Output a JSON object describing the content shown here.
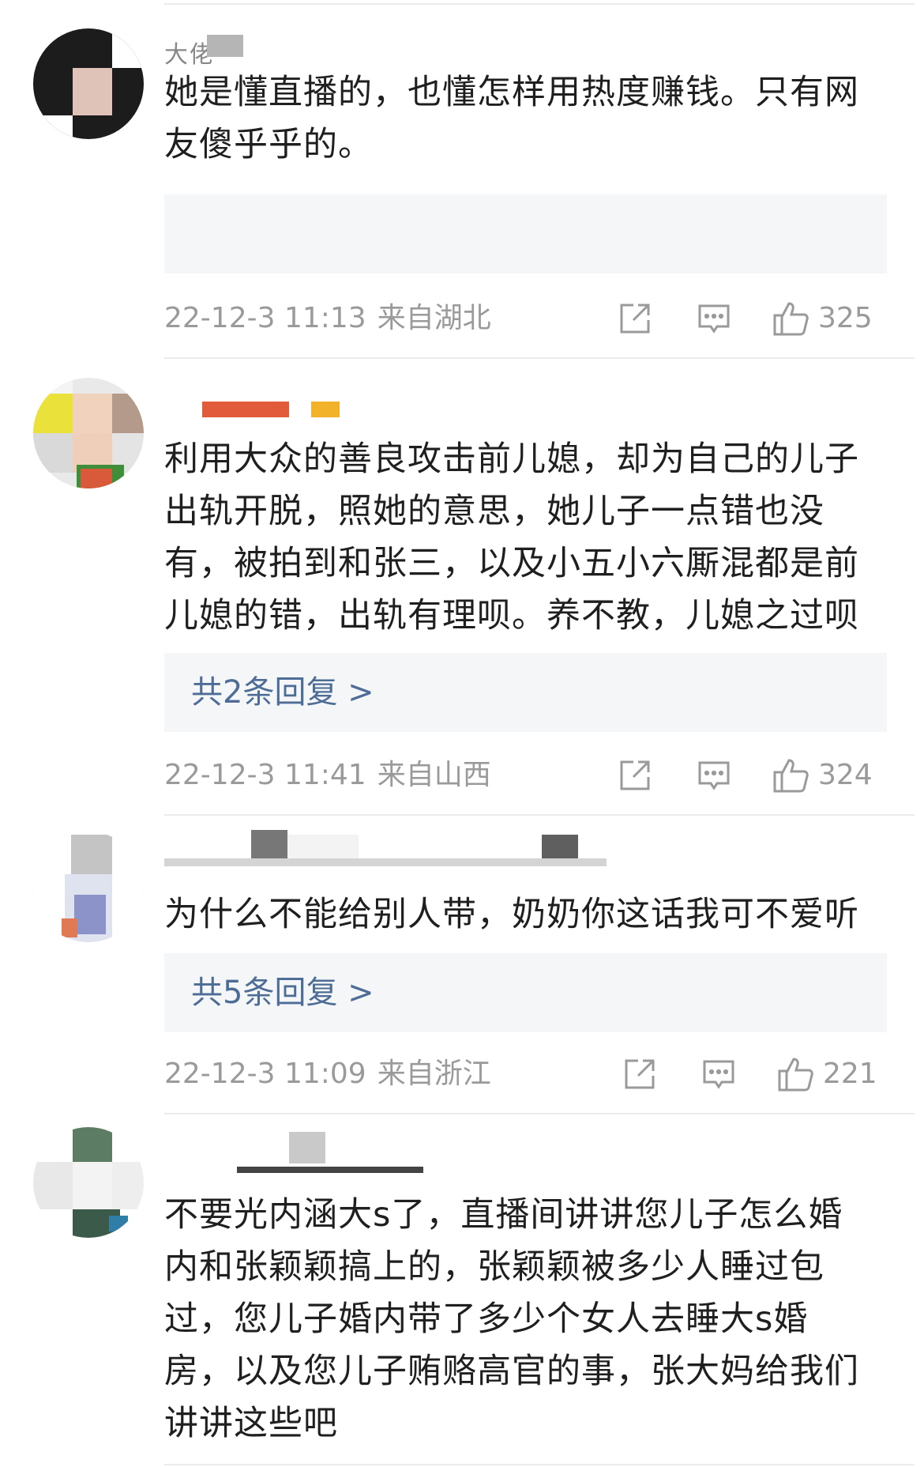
{
  "comments": [
    {
      "username": "大佬",
      "text_lines": [
        "她是懂直播的，也懂怎样用热度赚钱。只有网",
        "友傻乎乎的。"
      ],
      "reply_label": "",
      "time": "22-12-3 11:13",
      "location": "来自湖北",
      "likes": "325"
    },
    {
      "username": "",
      "text_lines": [
        "利用大众的善良攻击前儿媳，却为自己的儿子",
        "出轨开脱，照她的意思，她儿子一点错也没",
        "有，被拍到和张三，以及小五小六厮混都是前",
        "儿媳的错，出轨有理呗。养不教，儿媳之过呗"
      ],
      "reply_label": "共2条回复 >",
      "time": "22-12-3 11:41",
      "location": "来自山西",
      "likes": "324"
    },
    {
      "username": "",
      "text_lines": [
        "为什么不能给别人带，奶奶你这话我可不爱听"
      ],
      "reply_label": "共5条回复 >",
      "time": "22-12-3 11:09",
      "location": "来自浙江",
      "likes": "221"
    },
    {
      "username": "",
      "text_lines": [
        "不要光内涵大s了，直播间讲讲您儿子怎么婚",
        "内和张颖颖搞上的，张颖颖被多少人睡过包",
        "过，您儿子婚内带了多少个女人去睡大s婚",
        "房，以及您儿子贿赂高官的事，张大妈给我们",
        "讲讲这些吧"
      ]
    }
  ],
  "icons": {
    "share": "share-icon",
    "comment": "comment-icon",
    "like": "thumbs-up-icon"
  },
  "colors": {
    "reply_link": "#4e6d96",
    "meta_text": "#9a9a9a",
    "reply_bg": "#f5f6f7"
  }
}
